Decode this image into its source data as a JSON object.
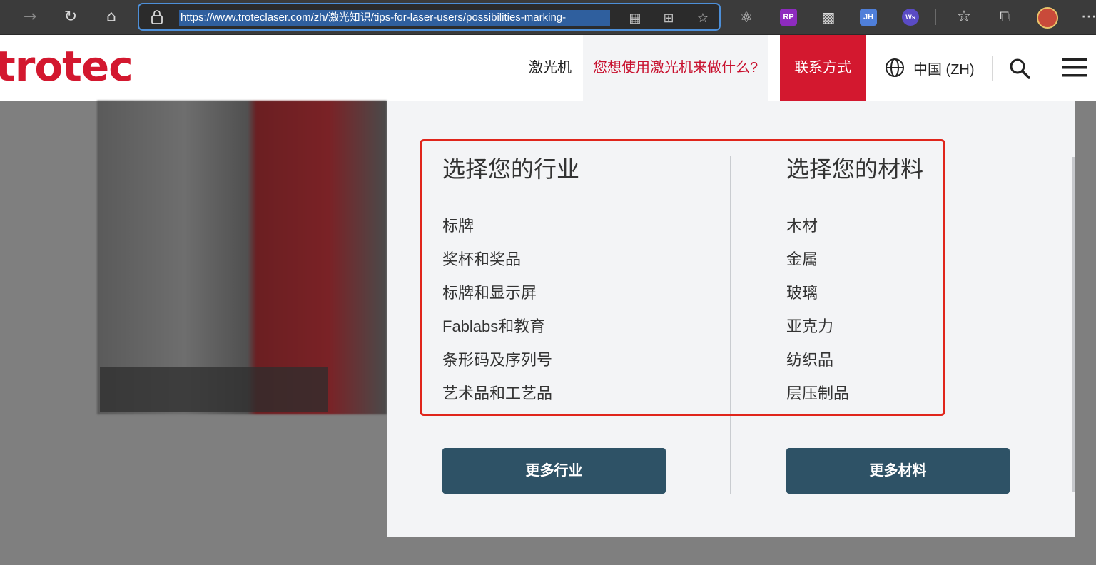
{
  "browser": {
    "url": "https://www.troteclaser.com/zh/激光知识/tips-for-laser-users/possibilities-marking-",
    "ext_rp": "RP",
    "ext_jh": "JH",
    "ext_ws": "Ws"
  },
  "header": {
    "logo": "trotec",
    "nav": {
      "lasers": "激光机",
      "what_to_do": "您想使用激光机来做什么?",
      "contact": "联系方式"
    },
    "language": "中国 (ZH)"
  },
  "dropdown": {
    "industry": {
      "title": "选择您的行业",
      "items": [
        "标牌",
        "奖杯和奖品",
        "标牌和显示屏",
        "Fablabs和教育",
        "条形码及序列号",
        "艺术品和工艺品"
      ],
      "more_button": "更多行业"
    },
    "material": {
      "title": "选择您的材料",
      "items": [
        "木材",
        "金属",
        "玻璃",
        "亚克力",
        "纺织品",
        "层压制品"
      ],
      "more_button": "更多材料"
    }
  },
  "colors": {
    "brand_red": "#d3182f",
    "button_blue": "#2e5266",
    "highlight": "#e0251b"
  }
}
